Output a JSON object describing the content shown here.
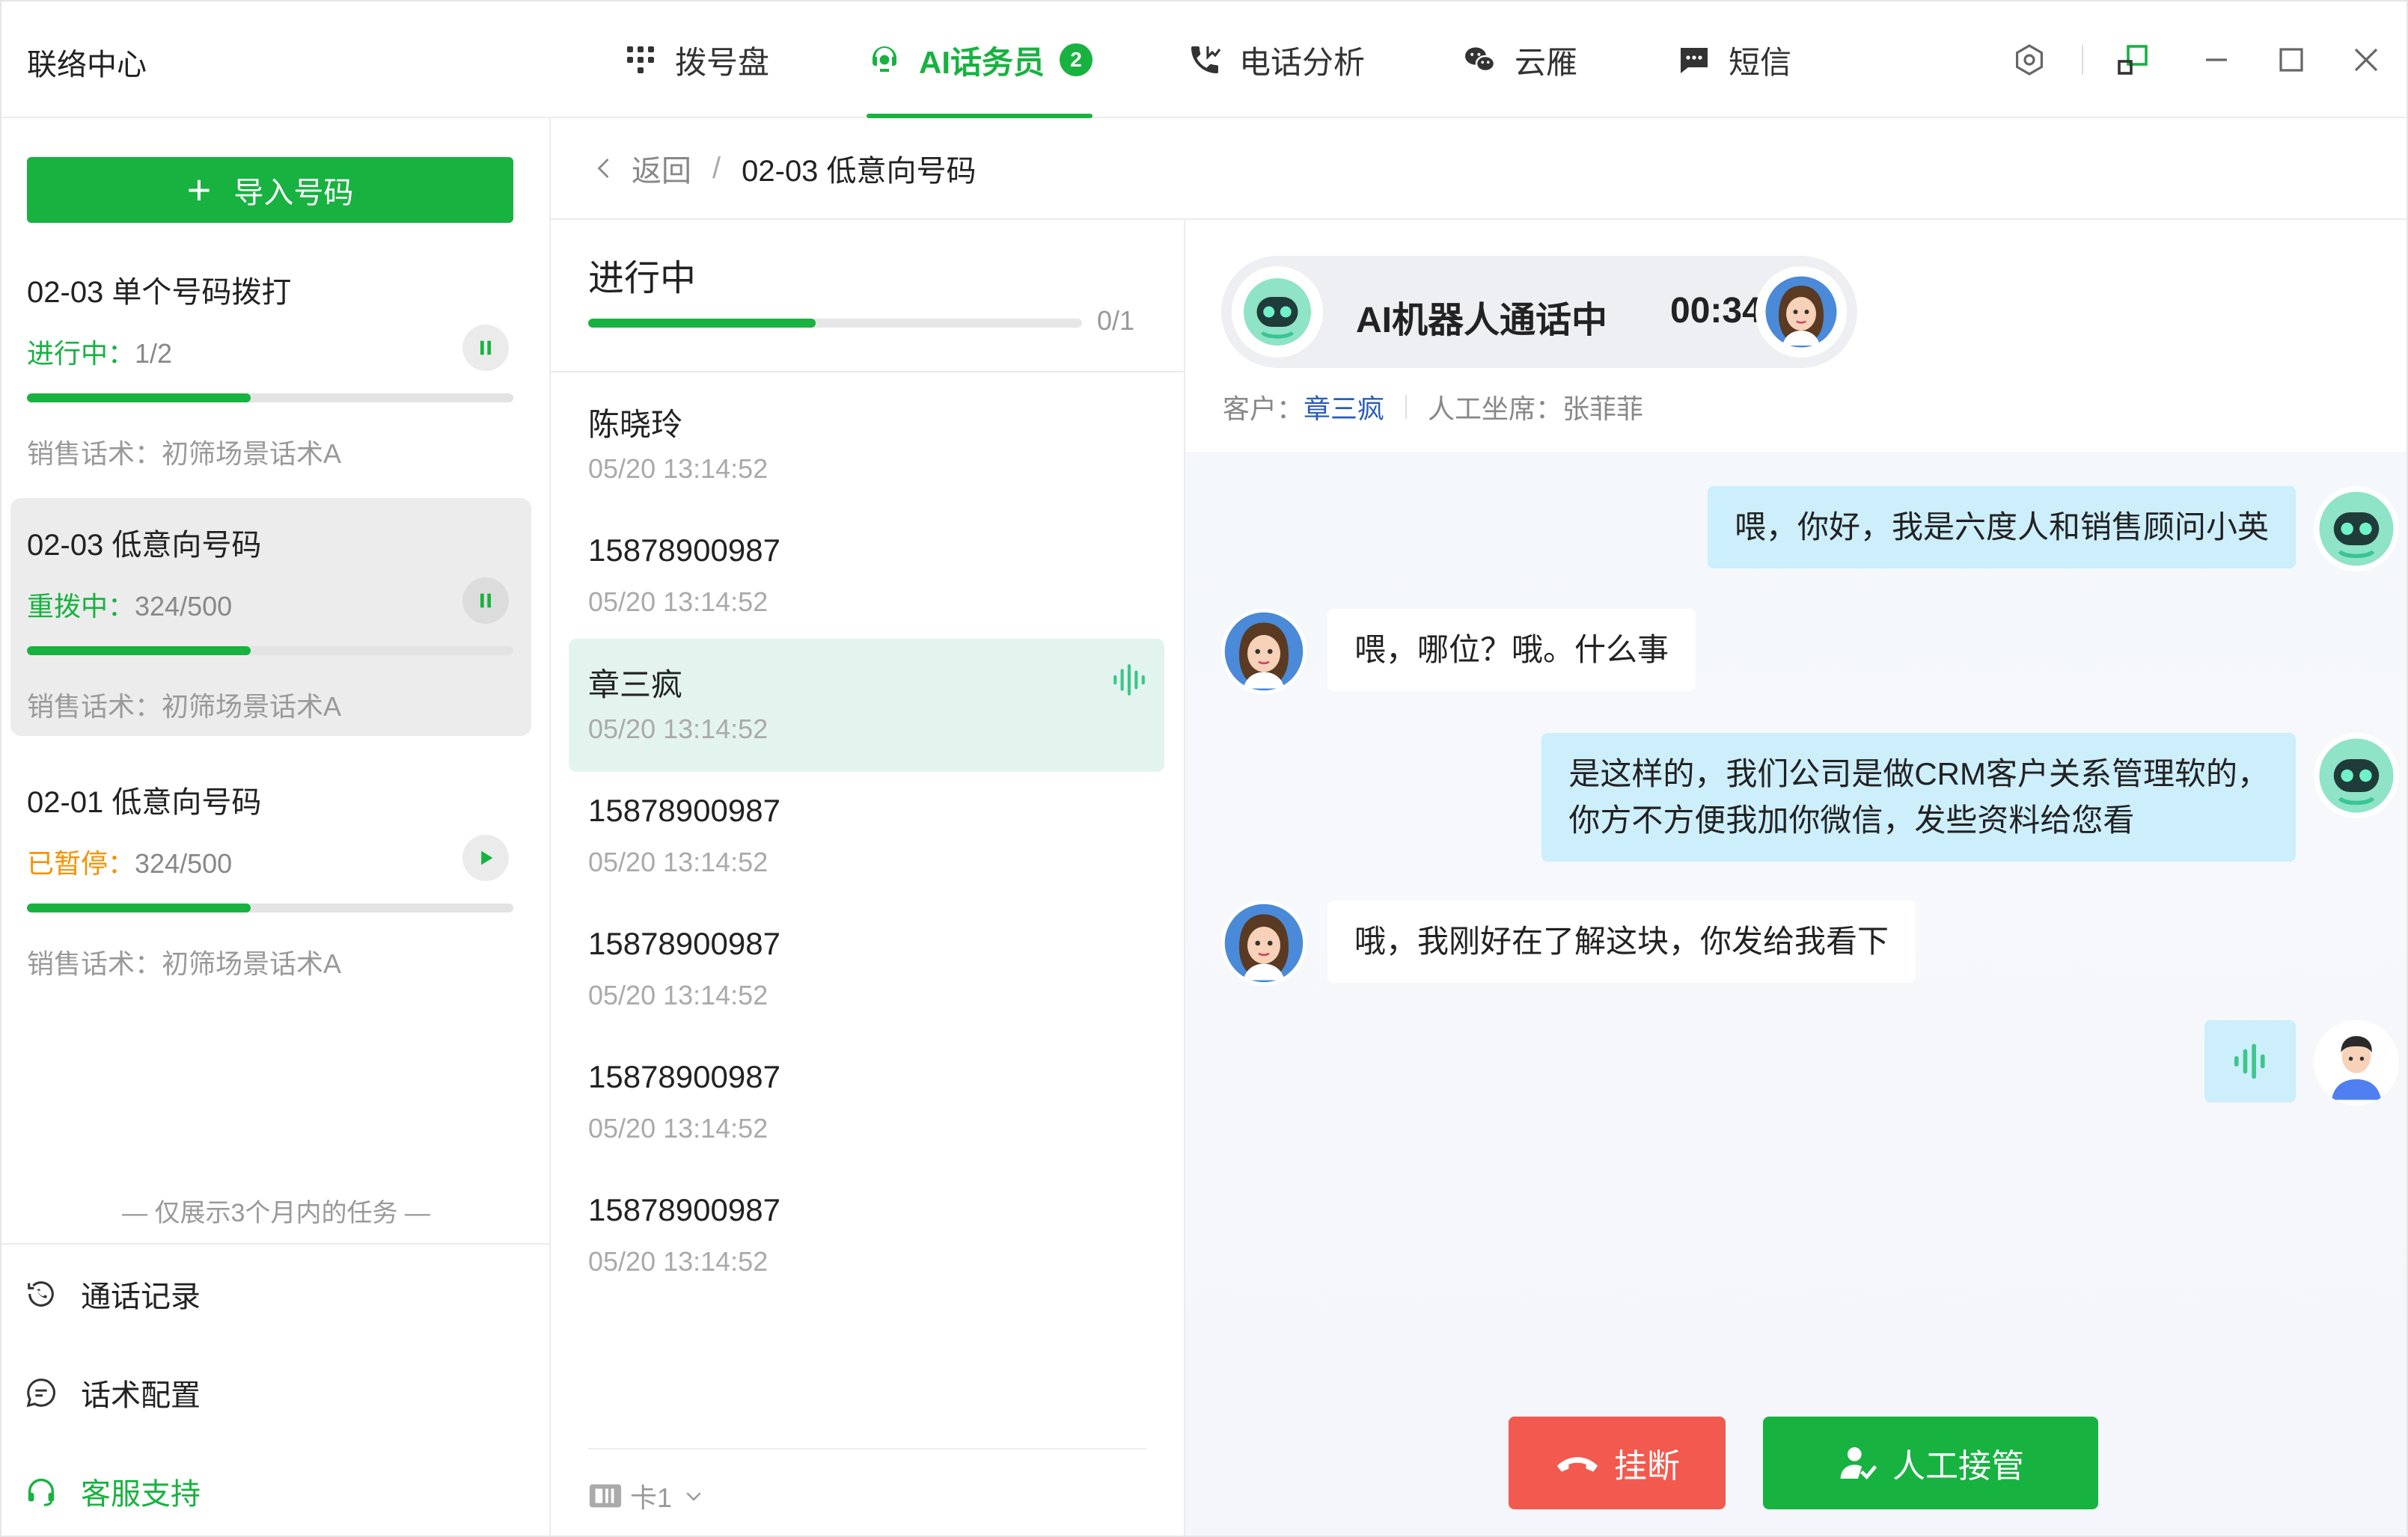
{
  "window": {
    "title": "联络中心"
  },
  "nav": {
    "tabs": [
      {
        "label": "拨号盘",
        "icon": "dialpad-icon"
      },
      {
        "label": "AI话务员",
        "icon": "ai-agent-icon",
        "badge": "2",
        "active": true
      },
      {
        "label": "电话分析",
        "icon": "phone-analysis-icon"
      },
      {
        "label": "云雁",
        "icon": "wechat-icon"
      },
      {
        "label": "短信",
        "icon": "sms-icon"
      }
    ]
  },
  "sidebar": {
    "import_label": "导入号码",
    "tasks": [
      {
        "title": "02-03 单个号码拨打",
        "status_label": "进行中：",
        "status_value": "1/2",
        "script": "销售话术：初筛场景话术A",
        "progress": 0.46,
        "control": "pause"
      },
      {
        "title": "02-03 低意向号码",
        "status_label": "重拨中：",
        "status_value": "324/500",
        "script": "销售话术：初筛场景话术A",
        "progress": 0.46,
        "control": "pause",
        "selected": true
      },
      {
        "title": "02-01 低意向号码",
        "status_label": "已暂停：",
        "status_value": "324/500",
        "script": "销售话术：初筛场景话术A",
        "progress": 0.46,
        "control": "play"
      }
    ],
    "only_note": "— 仅展示3个月内的任务 —",
    "links": [
      {
        "label": "通话记录",
        "icon": "call-history-icon"
      },
      {
        "label": "话术配置",
        "icon": "script-config-icon"
      },
      {
        "label": "客服支持",
        "icon": "headset-icon"
      }
    ]
  },
  "breadcrumb": {
    "back": "返回",
    "separator": "/",
    "current": "02-03 低意向号码"
  },
  "list": {
    "title": "进行中",
    "count": "0/1",
    "progress": 0.46,
    "items": [
      {
        "name": "陈晓玲",
        "time": "05/20 13:14:52"
      },
      {
        "name": "15878900987",
        "time": "05/20 13:14:52"
      },
      {
        "name": "章三疯",
        "time": "05/20 13:14:52",
        "active": true
      },
      {
        "name": "15878900987",
        "time": "05/20 13:14:52"
      },
      {
        "name": "15878900987",
        "time": "05/20 13:14:52"
      },
      {
        "name": "15878900987",
        "time": "05/20 13:14:52"
      },
      {
        "name": "15878900987",
        "time": "05/20 13:14:52"
      }
    ],
    "sim_label": "卡1"
  },
  "call": {
    "status": "AI机器人通话中",
    "timer": "00:34",
    "customer_label": "客户：",
    "customer_name": "章三疯",
    "agent_label": "人工坐席：",
    "agent_name": "张菲菲"
  },
  "messages": [
    {
      "from": "ai",
      "text": "喂，你好，我是六度人和销售顾问小英"
    },
    {
      "from": "customer",
      "text": "喂，哪位？哦。什么事"
    },
    {
      "from": "ai",
      "line1": "是这样的，我们公司是做CRM客户关系管理软的，",
      "line2": "你方不方便我加你微信，发些资料给您看"
    },
    {
      "from": "customer",
      "text": "哦，我刚好在了解这块，你发给我看下"
    },
    {
      "from": "agent",
      "type": "voice"
    }
  ],
  "actions": {
    "hangup": "挂断",
    "takeover": "人工接管"
  },
  "colors": {
    "brand_green": "#17b240",
    "hangup_red": "#f25a4f",
    "paused_orange": "#f39200",
    "ai_bubble": "#cdeefb"
  }
}
